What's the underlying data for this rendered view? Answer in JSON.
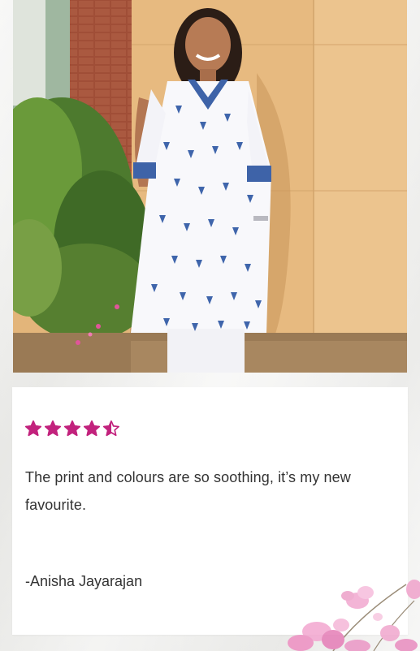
{
  "testimonial": {
    "rating": 4.5,
    "rating_max": 5,
    "star_color": "#c2227d",
    "quote": "The print and colours are so soothing, it’s my new favourite.",
    "author": "-Anisha Jayarajan"
  },
  "photo": {
    "icon": "customer-photo"
  }
}
